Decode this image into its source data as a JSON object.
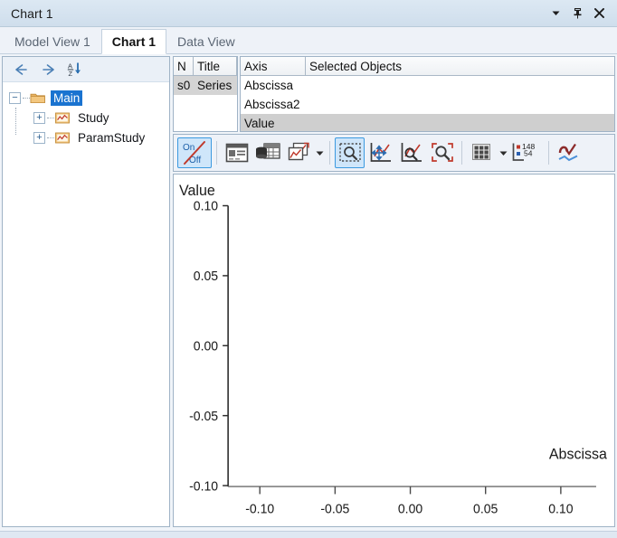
{
  "window": {
    "title": "Chart 1",
    "buttons": [
      {
        "name": "dropdown-menu-button",
        "glyph": "▼"
      },
      {
        "name": "pin-button",
        "glyph": "pin"
      },
      {
        "name": "close-button",
        "glyph": "✕"
      }
    ]
  },
  "tabs": [
    {
      "label": "Model View 1",
      "active": false
    },
    {
      "label": "Chart 1",
      "active": true
    },
    {
      "label": "Data View",
      "active": false
    }
  ],
  "tree": {
    "toolbar": [
      {
        "name": "back-button",
        "icon": "arrow-left-icon"
      },
      {
        "name": "forward-button",
        "icon": "arrow-right-icon"
      },
      {
        "name": "sort-az-button",
        "icon": "sort-az-icon"
      }
    ],
    "nodes": [
      {
        "label": "Main",
        "level": 0,
        "icon": "folder-icon",
        "expander": "minus",
        "selected": true
      },
      {
        "label": "Study",
        "level": 1,
        "icon": "chart-icon",
        "expander": "plus",
        "selected": false
      },
      {
        "label": "ParamStudy",
        "level": 1,
        "icon": "chart-icon",
        "expander": "plus",
        "selected": false
      }
    ]
  },
  "series_grid": {
    "headers": [
      "N",
      "Title"
    ],
    "rows": [
      {
        "n": "s0",
        "title": "Series"
      }
    ]
  },
  "axis_grid": {
    "headers": [
      "Axis",
      "Selected Objects"
    ],
    "rows": [
      {
        "axis": "Abscissa",
        "selected_objects": "",
        "highlighted": false
      },
      {
        "axis": "Abscissa2",
        "selected_objects": "",
        "highlighted": false
      },
      {
        "axis": "Value",
        "selected_objects": "",
        "highlighted": true
      }
    ]
  },
  "toolbar": {
    "buttons": [
      {
        "name": "on-off-toggle-button",
        "icon": "on-off-icon",
        "label_top": "On",
        "label_bottom": "Off",
        "active": true
      },
      {
        "name": "properties-button",
        "icon": "properties-panel-icon",
        "active": false
      },
      {
        "name": "data-source-button",
        "icon": "database-table-icon",
        "active": false
      },
      {
        "name": "add-plot-button",
        "icon": "add-plot-icon",
        "active": false
      },
      {
        "name": "add-plot-dropdown",
        "icon": "chevron-down-icon",
        "active": false
      },
      {
        "name": "zoom-box-tool-button",
        "icon": "zoom-box-icon",
        "active": true
      },
      {
        "name": "pan-tool-button",
        "icon": "pan-axes-icon",
        "active": false
      },
      {
        "name": "zoom-to-data-button",
        "icon": "zoom-curve-icon",
        "active": false
      },
      {
        "name": "zoom-reset-button",
        "icon": "zoom-reset-icon",
        "active": false
      },
      {
        "name": "grid-toggle-button",
        "icon": "grid-icon",
        "active": false
      },
      {
        "name": "grid-dropdown",
        "icon": "chevron-down-icon",
        "active": false
      },
      {
        "name": "legend-toggle-button",
        "icon": "legend-icon",
        "label_a": "148",
        "label_b": "54",
        "active": false
      },
      {
        "name": "smoothing-button",
        "icon": "curve-smoothing-icon",
        "active": false
      }
    ]
  },
  "chart_data": {
    "type": "scatter",
    "title": "",
    "xlabel": "Abscissa",
    "ylabel": "Value",
    "xlim": [
      -0.125,
      0.125
    ],
    "ylim": [
      -0.125,
      0.125
    ],
    "xticks": [
      "-0.10",
      "-0.05",
      "0.00",
      "0.05",
      "0.10"
    ],
    "xtick_values": [
      -0.1,
      -0.05,
      0.0,
      0.05,
      0.1
    ],
    "yticks": [
      "0.10",
      "0.05",
      "0.00",
      "-0.05",
      "-0.10"
    ],
    "ytick_values": [
      0.1,
      0.05,
      0.0,
      -0.05,
      -0.1
    ],
    "grid": false,
    "legend": null,
    "series": [
      {
        "name": "Series",
        "x": [],
        "y": []
      }
    ],
    "note": "empty plot - no data points drawn"
  },
  "colors": {
    "titlebar": "#d4e2ef",
    "accent": "#1a73d0",
    "toolbar_active_border": "#3c9ae0",
    "toolbar_active_fill": "#cfe6fa",
    "grid_selected_row": "#cfcfcf",
    "axis_line": "#3a3a3a",
    "folder": "#e8b062",
    "panel_border": "#9fb3c6"
  }
}
